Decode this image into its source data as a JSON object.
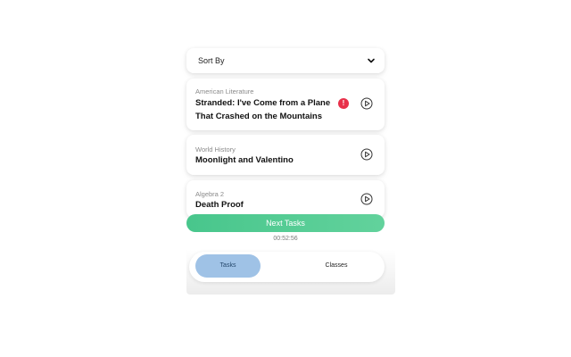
{
  "sort": {
    "label": "Sort By"
  },
  "tasks": [
    {
      "subject": "American Literature",
      "title": "Stranded: I've Come from a Plane That Crashed on the Mountains",
      "alert": "!"
    },
    {
      "subject": "World History",
      "title": "Moonlight and Valentino"
    },
    {
      "subject": "Algebra 2",
      "title": "Death Proof"
    }
  ],
  "actions": {
    "next_label": "Next Tasks"
  },
  "timer": {
    "value": "00:52:56"
  },
  "nav": {
    "tasks_label": "Tasks",
    "classes_label": "Classes"
  },
  "colors": {
    "accent_green": "#48c68c",
    "active_tab": "#9fc2e6",
    "alert_red": "#e8304a"
  }
}
